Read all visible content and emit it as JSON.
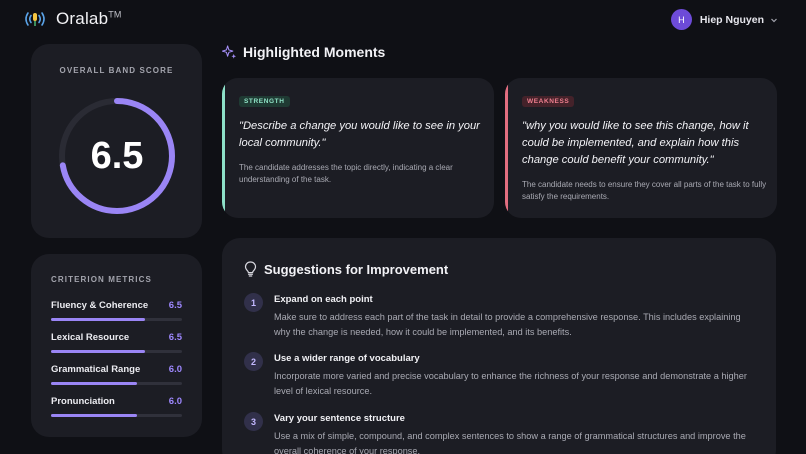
{
  "app": {
    "name": "Oralab",
    "trademark": "TM"
  },
  "user": {
    "initial": "H",
    "name": "Hiep Nguyen"
  },
  "score": {
    "title": "OVERALL BAND SCORE",
    "value": "6.5",
    "progress": 0.722
  },
  "metrics": {
    "title": "CRITERION METRICS",
    "items": [
      {
        "label": "Fluency & Coherence",
        "value": "6.5",
        "fill": 0.72
      },
      {
        "label": "Lexical Resource",
        "value": "6.5",
        "fill": 0.72
      },
      {
        "label": "Grammatical Range",
        "value": "6.0",
        "fill": 0.66
      },
      {
        "label": "Pronunciation",
        "value": "6.0",
        "fill": 0.66
      }
    ]
  },
  "highlights": {
    "title": "Highlighted Moments",
    "strength": {
      "badge": "STRENGTH",
      "quote": "\"Describe a change you would like to see in your local community.\"",
      "note": "The candidate addresses the topic directly, indicating a clear understanding of the task."
    },
    "weakness": {
      "badge": "WEAKNESS",
      "quote": "\"why you would like to see this change, how it could be implemented, and explain how this change could benefit your community.\"",
      "note": "The candidate needs to ensure they cover all parts of the task to fully satisfy the requirements."
    }
  },
  "suggestions": {
    "title": "Suggestions for Improvement",
    "items": [
      {
        "number": "1",
        "title": "Expand on each point",
        "text": "Make sure to address each part of the task in detail to provide a comprehensive response. This includes explaining why the change is needed, how it could be implemented, and its benefits."
      },
      {
        "number": "2",
        "title": "Use a wider range of vocabulary",
        "text": "Incorporate more varied and precise vocabulary to enhance the richness of your response and demonstrate a higher level of lexical resource."
      },
      {
        "number": "3",
        "title": "Vary your sentence structure",
        "text": "Use a mix of simple, compound, and complex sentences to show a range of grammatical structures and improve the overall coherence of your response."
      }
    ]
  },
  "colors": {
    "accent": "#9a85f5",
    "strength": "#8de0c8",
    "weakness": "#e26e80",
    "card": "#1c1d24",
    "background": "#0f1015"
  }
}
